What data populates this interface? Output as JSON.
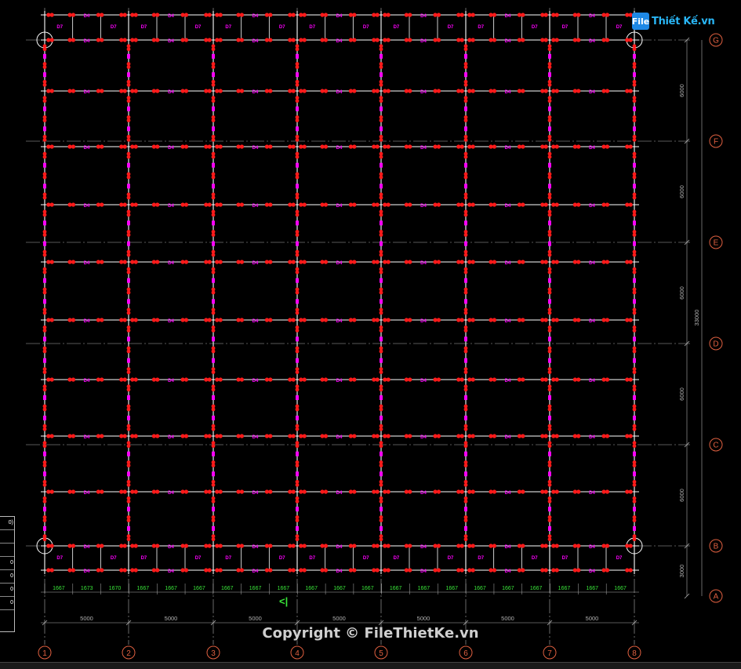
{
  "watermark": {
    "logo_mark": "File",
    "logo_text": "Thiết Kế.vn",
    "copyright": "Copyright © FileThietKe.vn"
  },
  "grid": {
    "column_labels": [
      "1",
      "2",
      "3",
      "4",
      "5",
      "6",
      "7",
      "8"
    ],
    "row_labels": [
      "G",
      "F",
      "E",
      "D",
      "C",
      "B",
      "A"
    ],
    "bay_dimensions": [
      "5000",
      "5000",
      "5000",
      "5000",
      "5000",
      "5000",
      "5000"
    ],
    "row_dimensions": [
      "6000",
      "6000",
      "6000",
      "6000",
      "6000",
      "3000"
    ],
    "overall_dimension": "33000",
    "sub_dimensions": [
      "1667",
      "1673",
      "1670",
      "1667",
      "1667",
      "1667",
      "1667",
      "1667",
      "1667",
      "1667",
      "1667",
      "1667",
      "1667",
      "1667",
      "1667",
      "1667",
      "1667",
      "1667",
      "1667",
      "1667",
      "1667"
    ],
    "beam_mark": "D4",
    "joist_mark": "D7"
  },
  "section_marker": "<|",
  "legend": {
    "rows": [
      "0)",
      "",
      "",
      "0",
      "0",
      "0",
      "0"
    ]
  },
  "colors": {
    "background": "#000000",
    "grid_line": "#b0b0b0",
    "beam": "#ffffff",
    "bolt": "#ff1a1a",
    "tag": "#ff00ff",
    "bubble": "#e06040",
    "dimension_green": "#39e639"
  }
}
